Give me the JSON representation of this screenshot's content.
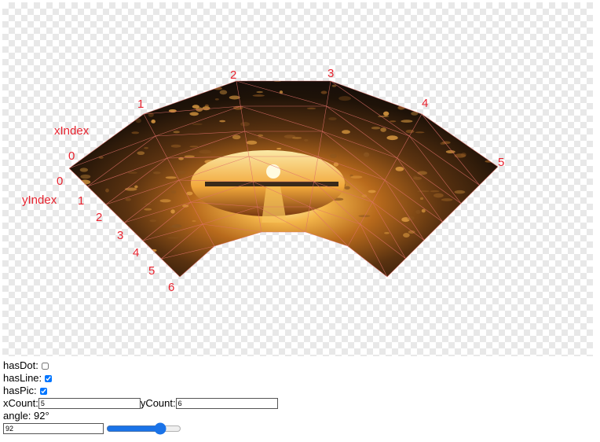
{
  "canvas": {
    "axis_labels": {
      "x": "xIndex",
      "y": "yIndex"
    },
    "x_tick_labels": [
      "0",
      "1",
      "2",
      "3",
      "4",
      "5"
    ],
    "y_tick_labels": [
      "0",
      "1",
      "2",
      "3",
      "4",
      "5",
      "6"
    ],
    "image_description": "wave tube at sunset",
    "mesh_line_color": "#e0706a",
    "label_color": "#e8232f"
  },
  "controls": {
    "has_dot": {
      "label": "hasDot:",
      "checked": false
    },
    "has_line": {
      "label": "hasLine:",
      "checked": true
    },
    "has_pic": {
      "label": "hasPic:",
      "checked": true
    },
    "x_count": {
      "label": "xCount:",
      "value": "5"
    },
    "y_count": {
      "label": "yCount:",
      "value": "6"
    },
    "angle": {
      "label": "angle: 92°",
      "value": "92",
      "slider_value": 92,
      "slider_min": 0,
      "slider_max": 120
    }
  }
}
